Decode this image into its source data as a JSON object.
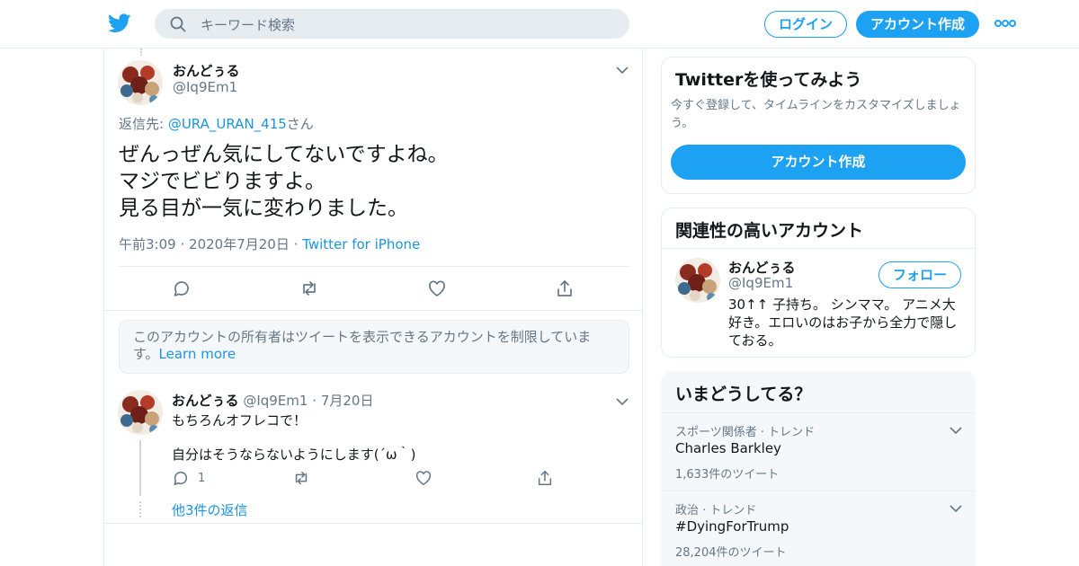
{
  "header": {
    "logo_icon": "twitter-bird-icon",
    "search_placeholder": "キーワード検索",
    "login_label": "ログイン",
    "signup_label": "アカウント作成",
    "more_icon": "more-dots-icon",
    "brand_color": "#1da1f2"
  },
  "tweet": {
    "name": "おんどぅる",
    "handle": "@Iq9Em1",
    "reply_prefix": "返信先: ",
    "reply_mention": "@URA_URAN_415",
    "reply_suffix": "さん",
    "lines": [
      "ぜんっぜん気にしてないですよね。",
      "マジでビビりますよ。",
      "見る目が一気に変わりました。"
    ],
    "time": "午前3:09",
    "date": "2020年7月20日",
    "source": "Twitter for iPhone",
    "sep": "·"
  },
  "notice": {
    "text": "このアカウントの所有者はツイートを表示できるアカウントを制限しています。",
    "link": "Learn more"
  },
  "reply": {
    "name": "おんどぅる",
    "handle": "@Iq9Em1",
    "sep": "·",
    "date": "7月20日",
    "text1": "もちろんオフレコで！",
    "text2": "自分はそうならないようにします(´ω｀)",
    "reply_count": "1",
    "more_replies": "他3件の返信"
  },
  "sidebar": {
    "signup_card": {
      "title": "Twitterを使ってみよう",
      "desc": "今すぐ登録して、タイムラインをカスタマイズしましょう。",
      "button": "アカウント作成"
    },
    "related": {
      "title": "関連性の高いアカウント",
      "name": "おんどぅる",
      "handle": "@Iq9Em1",
      "follow": "フォロー",
      "bio": "30↑↑ 子持ち。 シンママ。 アニメ大好き。エロいのはお子から全力で隠しておる。"
    },
    "trends": {
      "title": "いまどうしてる？",
      "items": [
        {
          "meta": "スポーツ関係者 · トレンド",
          "name": "Charles Barkley",
          "count": "1,633件のツイート"
        },
        {
          "meta": "政治 · トレンド",
          "name": "#DyingForTrump",
          "count": "28,204件のツイート"
        }
      ]
    }
  }
}
